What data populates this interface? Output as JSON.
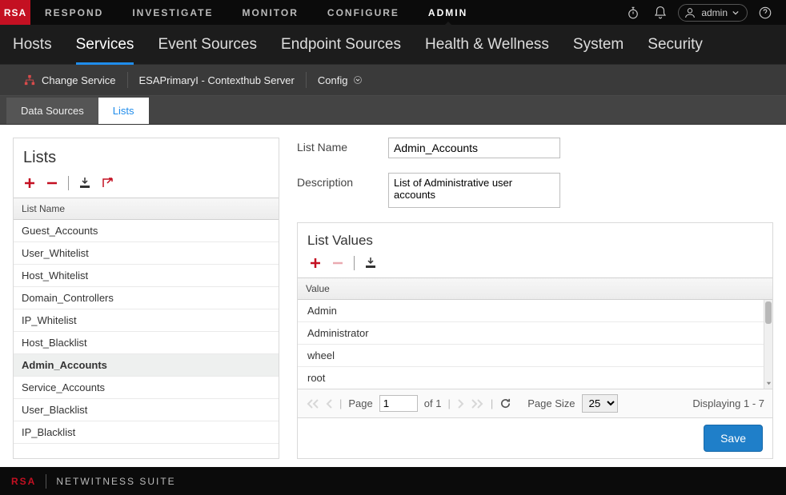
{
  "brand": "RSA",
  "topnav": {
    "items": [
      "RESPOND",
      "INVESTIGATE",
      "MONITOR",
      "CONFIGURE",
      "ADMIN"
    ],
    "active": 4
  },
  "toprightUser": "admin",
  "subnav": {
    "items": [
      "Hosts",
      "Services",
      "Event Sources",
      "Endpoint Sources",
      "Health & Wellness",
      "System",
      "Security"
    ],
    "active": 1
  },
  "breadcrumb": {
    "change_service": "Change Service",
    "path": "ESAPrimaryI - Contexthub Server",
    "config": "Config"
  },
  "tabs": {
    "items": [
      "Data Sources",
      "Lists"
    ],
    "active": 1
  },
  "lists_panel": {
    "title": "Lists",
    "header": "List Name",
    "rows": [
      "Guest_Accounts",
      "User_Whitelist",
      "Host_Whitelist",
      "Domain_Controllers",
      "IP_Whitelist",
      "Host_Blacklist",
      "Admin_Accounts",
      "Service_Accounts",
      "User_Blacklist",
      "IP_Blacklist"
    ],
    "selected": 6
  },
  "form": {
    "list_name_label": "List Name",
    "list_name_value": "Admin_Accounts",
    "description_label": "Description",
    "description_value": "List of Administrative user accounts"
  },
  "list_values": {
    "title": "List Values",
    "header": "Value",
    "rows": [
      "Admin",
      "Administrator",
      "wheel",
      "root"
    ]
  },
  "paging": {
    "page_label": "Page",
    "page_value": "1",
    "of_label": "of 1",
    "page_size_label": "Page Size",
    "page_size_value": "25",
    "status": "Displaying 1 - 7"
  },
  "save_label": "Save",
  "footer": {
    "brand": "RSA",
    "product": "NETWITNESS SUITE"
  }
}
